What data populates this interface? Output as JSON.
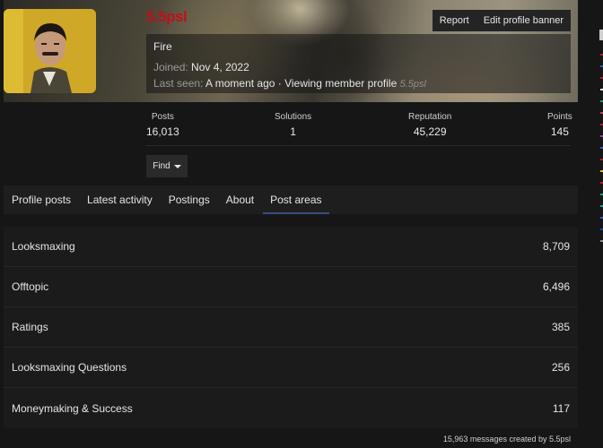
{
  "profile": {
    "username": "5.5psl",
    "title": "Fire",
    "joined_label": "Joined:",
    "joined_value": "Nov 4, 2022",
    "last_seen_label": "Last seen:",
    "last_seen_value": "A moment ago · Viewing member profile",
    "last_seen_user": "5.5psl"
  },
  "actions": {
    "report": "Report",
    "edit_banner": "Edit profile banner",
    "find": "Find"
  },
  "stats": [
    {
      "label": "Posts",
      "value": "16,013"
    },
    {
      "label": "Solutions",
      "value": "1"
    },
    {
      "label": "Reputation",
      "value": "45,229"
    },
    {
      "label": "Points",
      "value": "145"
    }
  ],
  "tabs": [
    {
      "label": "Profile posts"
    },
    {
      "label": "Latest activity"
    },
    {
      "label": "Postings"
    },
    {
      "label": "About"
    },
    {
      "label": "Post areas",
      "active": true
    }
  ],
  "post_areas": [
    {
      "name": "Looksmaxing",
      "count": "8,709"
    },
    {
      "name": "Offtopic",
      "count": "6,496"
    },
    {
      "name": "Ratings",
      "count": "385"
    },
    {
      "name": "Looksmaxing Questions",
      "count": "256"
    },
    {
      "name": "Moneymaking & Success",
      "count": "117"
    }
  ],
  "footer": "15,963 messages created by 5.5psl",
  "colors": {
    "username": "#c0101a",
    "tab_active_underline": "#3a4c86",
    "side_dots": [
      "#b02030",
      "#3060c0",
      "#b02030",
      "#e8e8e8",
      "#20a060",
      "#c04060",
      "#b02030",
      "#a040c0",
      "#3060c0",
      "#b02030",
      "#e0c020",
      "#c02020",
      "#20a080",
      "#20a0a0",
      "#3060c0",
      "#2040a0",
      "#909090"
    ]
  }
}
